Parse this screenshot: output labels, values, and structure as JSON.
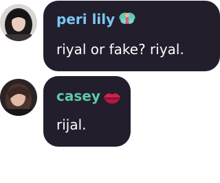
{
  "messages": [
    {
      "username": "peri lily",
      "username_color": "#7cc7f2",
      "badge": "fairy-emoji",
      "text": "riyal or fake? riyal."
    },
    {
      "username": "casey",
      "username_color": "#5fc9a8",
      "badge": "kiss-mark-emoji",
      "text": "rijal."
    }
  ]
}
